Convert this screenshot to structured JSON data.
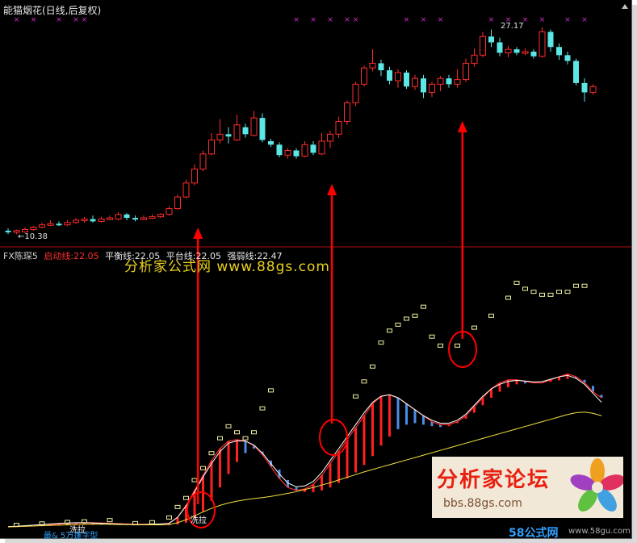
{
  "window": {
    "title": "能猫烟花(日线,后复权)"
  },
  "price_labels": {
    "high": "27.17",
    "low": "←10.38"
  },
  "indicator": {
    "name": "FX陈琛5",
    "start_line": "启动线:22.05",
    "balance_line": "平衡线:22.05",
    "platform_line": "平台线:22.05",
    "strength_line": "强弱线:22.47"
  },
  "watermark": {
    "text": "分析家公式网 www.88gs.com"
  },
  "forum_logo": {
    "title": "分析家论坛",
    "url": "bbs.88gs.com"
  },
  "bottom": {
    "logo": "58公式网",
    "url": "www.58gu.com",
    "label": "最& 5万篷字型"
  },
  "marks": {
    "left": "洗拉",
    "right": "洗拉"
  },
  "colors": {
    "up": "#ff2b2b",
    "down": "#5ce6e6",
    "arrow": "#ff0000",
    "bar_red": "#ff2020",
    "bar_blue": "#4a8ee8",
    "line_yellow": "#f0e040",
    "signal_x": "#d030d0"
  },
  "candles": [
    {
      "o": 10.5,
      "c": 10.4,
      "h": 10.7,
      "l": 10.2
    },
    {
      "o": 10.4,
      "c": 10.5,
      "h": 10.6,
      "l": 10.2
    },
    {
      "o": 10.4,
      "c": 10.6,
      "h": 10.8,
      "l": 10.3
    },
    {
      "o": 10.6,
      "c": 10.8,
      "h": 10.9,
      "l": 10.5
    },
    {
      "o": 10.8,
      "c": 11.0,
      "h": 11.2,
      "l": 10.7
    },
    {
      "o": 11.0,
      "c": 11.1,
      "h": 11.4,
      "l": 10.9
    },
    {
      "o": 11.1,
      "c": 11.0,
      "h": 11.3,
      "l": 10.9
    },
    {
      "o": 11.0,
      "c": 11.2,
      "h": 11.4,
      "l": 10.9
    },
    {
      "o": 11.2,
      "c": 11.4,
      "h": 11.6,
      "l": 11.1
    },
    {
      "o": 11.4,
      "c": 11.5,
      "h": 11.7,
      "l": 11.2
    },
    {
      "o": 11.5,
      "c": 11.3,
      "h": 11.8,
      "l": 11.2
    },
    {
      "o": 11.3,
      "c": 11.5,
      "h": 11.7,
      "l": 11.2
    },
    {
      "o": 11.5,
      "c": 11.6,
      "h": 11.8,
      "l": 11.4
    },
    {
      "o": 11.5,
      "c": 11.9,
      "h": 12.1,
      "l": 11.4
    },
    {
      "o": 11.9,
      "c": 11.6,
      "h": 12.0,
      "l": 11.4
    },
    {
      "o": 11.6,
      "c": 11.5,
      "h": 11.8,
      "l": 11.3
    },
    {
      "o": 11.5,
      "c": 11.6,
      "h": 11.8,
      "l": 11.4
    },
    {
      "o": 11.6,
      "c": 11.7,
      "h": 11.9,
      "l": 11.5
    },
    {
      "o": 11.7,
      "c": 11.9,
      "h": 12.0,
      "l": 11.6
    },
    {
      "o": 11.9,
      "c": 12.4,
      "h": 12.6,
      "l": 11.8
    },
    {
      "o": 12.4,
      "c": 13.4,
      "h": 13.6,
      "l": 12.3
    },
    {
      "o": 13.4,
      "c": 14.6,
      "h": 14.9,
      "l": 13.3
    },
    {
      "o": 14.6,
      "c": 15.8,
      "h": 16.2,
      "l": 14.4
    },
    {
      "o": 15.8,
      "c": 17.1,
      "h": 17.4,
      "l": 15.6
    },
    {
      "o": 17.1,
      "c": 18.3,
      "h": 18.9,
      "l": 17.0
    },
    {
      "o": 18.3,
      "c": 18.8,
      "h": 20.1,
      "l": 18.0
    },
    {
      "o": 18.8,
      "c": 18.6,
      "h": 19.4,
      "l": 18.0
    },
    {
      "o": 18.3,
      "c": 19.6,
      "h": 20.5,
      "l": 18.2
    },
    {
      "o": 19.4,
      "c": 18.8,
      "h": 19.7,
      "l": 18.5
    },
    {
      "o": 18.7,
      "c": 20.2,
      "h": 20.8,
      "l": 18.6
    },
    {
      "o": 20.2,
      "c": 18.3,
      "h": 20.6,
      "l": 18.1
    },
    {
      "o": 18.2,
      "c": 17.9,
      "h": 18.4,
      "l": 17.7
    },
    {
      "o": 17.9,
      "c": 17.0,
      "h": 18.1,
      "l": 16.8
    },
    {
      "o": 17.0,
      "c": 17.4,
      "h": 17.6,
      "l": 16.7
    },
    {
      "o": 17.4,
      "c": 16.9,
      "h": 17.6,
      "l": 16.7
    },
    {
      "o": 16.9,
      "c": 17.9,
      "h": 18.2,
      "l": 16.8
    },
    {
      "o": 17.9,
      "c": 17.2,
      "h": 18.2,
      "l": 17.0
    },
    {
      "o": 17.1,
      "c": 18.2,
      "h": 18.9,
      "l": 17.0
    },
    {
      "o": 18.2,
      "c": 18.8,
      "h": 19.1,
      "l": 17.6
    },
    {
      "o": 18.8,
      "c": 19.9,
      "h": 20.3,
      "l": 18.5
    },
    {
      "o": 19.9,
      "c": 21.5,
      "h": 21.7,
      "l": 19.6
    },
    {
      "o": 21.5,
      "c": 23.1,
      "h": 23.3,
      "l": 21.2
    },
    {
      "o": 23.1,
      "c": 24.5,
      "h": 24.7,
      "l": 22.9
    },
    {
      "o": 24.5,
      "c": 24.9,
      "h": 26.1,
      "l": 24.2
    },
    {
      "o": 24.9,
      "c": 24.3,
      "h": 25.2,
      "l": 23.8
    },
    {
      "o": 24.3,
      "c": 23.4,
      "h": 24.6,
      "l": 23.1
    },
    {
      "o": 23.4,
      "c": 24.1,
      "h": 24.4,
      "l": 22.8
    },
    {
      "o": 24.1,
      "c": 22.9,
      "h": 24.3,
      "l": 22.7
    },
    {
      "o": 22.9,
      "c": 23.6,
      "h": 23.9,
      "l": 22.6
    },
    {
      "o": 23.6,
      "c": 22.4,
      "h": 23.9,
      "l": 21.9
    },
    {
      "o": 22.4,
      "c": 23.1,
      "h": 23.3,
      "l": 22.0
    },
    {
      "o": 23.1,
      "c": 23.6,
      "h": 23.8,
      "l": 22.5
    },
    {
      "o": 23.6,
      "c": 23.1,
      "h": 23.9,
      "l": 22.8
    },
    {
      "o": 23.1,
      "c": 23.5,
      "h": 24.4,
      "l": 22.8
    },
    {
      "o": 23.5,
      "c": 24.9,
      "h": 25.3,
      "l": 23.3
    },
    {
      "o": 24.9,
      "c": 25.6,
      "h": 26.2,
      "l": 24.6
    },
    {
      "o": 25.6,
      "c": 27.2,
      "h": 27.6,
      "l": 25.4
    },
    {
      "o": 27.2,
      "c": 26.7,
      "h": 27.8,
      "l": 26.3
    },
    {
      "o": 26.7,
      "c": 25.8,
      "h": 27.1,
      "l": 25.5
    },
    {
      "o": 25.8,
      "c": 26.1,
      "h": 26.4,
      "l": 25.4
    },
    {
      "o": 26.1,
      "c": 25.8,
      "h": 26.3,
      "l": 25.6
    },
    {
      "o": 25.8,
      "c": 25.9,
      "h": 26.2,
      "l": 25.6
    },
    {
      "o": 25.9,
      "c": 25.5,
      "h": 26.1,
      "l": 25.3
    },
    {
      "o": 25.5,
      "c": 27.6,
      "h": 28.0,
      "l": 25.4
    },
    {
      "o": 27.6,
      "c": 26.3,
      "h": 27.8,
      "l": 25.9
    },
    {
      "o": 26.3,
      "c": 25.6,
      "h": 26.6,
      "l": 25.2
    },
    {
      "o": 25.6,
      "c": 25.1,
      "h": 25.9,
      "l": 24.8
    },
    {
      "o": 25.1,
      "c": 23.2,
      "h": 25.3,
      "l": 23.0
    },
    {
      "o": 23.2,
      "c": 22.4,
      "h": 23.6,
      "l": 21.6
    },
    {
      "o": 22.4,
      "c": 22.9,
      "h": 23.1,
      "l": 22.2
    }
  ],
  "signal_x_candles": [
    1,
    3,
    6,
    8,
    9,
    34,
    36,
    38,
    40,
    41,
    47,
    49,
    51,
    57,
    59,
    61,
    63,
    66,
    68
  ],
  "indicator_series": {
    "strong": [
      0.8,
      0.9,
      1.0,
      1.1,
      1.3,
      1.5,
      1.8,
      2.0,
      2.1,
      2.2,
      2.2,
      2.1,
      2.0,
      1.9,
      1.8,
      1.7,
      1.7,
      1.7,
      1.8,
      2.0,
      4.0,
      8.0,
      13,
      18,
      23,
      27,
      29.5,
      30,
      29.5,
      28,
      25,
      21,
      17,
      14,
      13,
      13.5,
      15,
      18,
      22,
      26,
      30,
      34,
      38,
      42,
      44.5,
      45,
      44,
      42,
      40,
      38,
      36,
      35,
      35,
      36,
      38,
      41,
      44,
      47,
      49,
      50,
      50,
      49.5,
      49,
      49,
      50,
      51,
      52,
      51,
      49,
      46,
      44
    ],
    "weak": [
      0.8,
      0.8,
      0.9,
      0.9,
      1.0,
      1.1,
      1.2,
      1.3,
      1.4,
      1.5,
      1.5,
      1.5,
      1.5,
      1.5,
      1.4,
      1.4,
      1.4,
      1.4,
      1.4,
      1.4,
      1.6,
      2.2,
      3.6,
      6.0,
      9.5,
      14,
      18.5,
      22.5,
      25.5,
      27,
      26,
      23,
      20,
      16.5,
      14,
      12.5,
      12.4,
      13,
      14,
      15.5,
      17,
      19,
      21.5,
      24.5,
      28,
      31,
      33.5,
      35,
      35.5,
      35,
      34.5,
      34.2,
      34.5,
      35.5,
      37,
      39,
      41.5,
      44,
      46,
      47.5,
      48.5,
      48.8,
      48.8,
      49,
      49.3,
      49.8,
      50.3,
      50.5,
      50,
      48,
      45
    ],
    "yellow": [
      0.8,
      0.9,
      1.0,
      1.1,
      1.2,
      1.3,
      1.4,
      1.5,
      1.6,
      1.7,
      1.7,
      1.7,
      1.7,
      1.6,
      1.6,
      1.5,
      1.5,
      1.5,
      1.5,
      1.6,
      2.2,
      3.2,
      4.5,
      5.8,
      7.0,
      8.0,
      8.8,
      9.4,
      9.9,
      10.3,
      10.6,
      11.0,
      11.5,
      12.0,
      12.6,
      13.3,
      14.0,
      14.8,
      15.6,
      16.5,
      17.4,
      18.3,
      19.2,
      20.0,
      20.8,
      21.6,
      22.4,
      23.2,
      24.0,
      24.8,
      25.6,
      26.4,
      27.2,
      28.0,
      28.8,
      29.6,
      30.4,
      31.2,
      32.0,
      32.8,
      33.6,
      34.4,
      35.2,
      36.0,
      36.8,
      37.6,
      38.4,
      39.0,
      39.2,
      38.8,
      38.0
    ],
    "white": [
      0.9,
      1.0,
      1.2,
      1.4,
      1.6,
      1.8,
      2.0,
      2.1,
      2.2,
      2.2,
      2.1,
      2.0,
      1.9,
      1.8,
      1.7,
      1.6,
      1.6,
      1.7,
      1.8,
      2.0,
      4.0,
      7.8,
      12.5,
      17.5,
      22,
      26,
      28.8,
      29.6,
      29.5,
      28.2,
      25.5,
      22,
      18.5,
      15.5,
      14.2,
      14.5,
      16,
      19,
      23,
      27,
      31,
      35,
      39,
      42.5,
      44.5,
      45,
      44,
      42,
      40,
      38,
      36.5,
      35.5,
      35.5,
      36.5,
      38.5,
      41.5,
      44.5,
      47,
      48.5,
      49.5,
      49.8,
      49.6,
      49.3,
      49.4,
      50.2,
      51,
      51.5,
      50.5,
      48.5,
      45.5,
      42.5
    ],
    "dashes": [
      {
        "i": 1,
        "v": 2
      },
      {
        "i": 4,
        "v": 2.5
      },
      {
        "i": 7,
        "v": 3
      },
      {
        "i": 9,
        "v": 3.2
      },
      {
        "i": 12,
        "v": 3.6
      },
      {
        "i": 15,
        "v": 2.6
      },
      {
        "i": 17,
        "v": 2.9
      },
      {
        "i": 19,
        "v": 4.5
      },
      {
        "i": 20,
        "v": 8
      },
      {
        "i": 21,
        "v": 11
      },
      {
        "i": 22,
        "v": 17
      },
      {
        "i": 23,
        "v": 21
      },
      {
        "i": 24,
        "v": 26
      },
      {
        "i": 25,
        "v": 31
      },
      {
        "i": 26,
        "v": 35
      },
      {
        "i": 27,
        "v": 33
      },
      {
        "i": 28,
        "v": 31
      },
      {
        "i": 29,
        "v": 33
      },
      {
        "i": 30,
        "v": 41
      },
      {
        "i": 31,
        "v": 47
      },
      {
        "i": 41,
        "v": 45
      },
      {
        "i": 42,
        "v": 50
      },
      {
        "i": 43,
        "v": 55
      },
      {
        "i": 44,
        "v": 63
      },
      {
        "i": 45,
        "v": 67
      },
      {
        "i": 46,
        "v": 69
      },
      {
        "i": 47,
        "v": 71
      },
      {
        "i": 48,
        "v": 72
      },
      {
        "i": 49,
        "v": 75
      },
      {
        "i": 50,
        "v": 65
      },
      {
        "i": 51,
        "v": 62
      },
      {
        "i": 53,
        "v": 62
      },
      {
        "i": 55,
        "v": 68
      },
      {
        "i": 57,
        "v": 72
      },
      {
        "i": 59,
        "v": 78
      },
      {
        "i": 60,
        "v": 83
      },
      {
        "i": 61,
        "v": 81
      },
      {
        "i": 62,
        "v": 80
      },
      {
        "i": 63,
        "v": 79
      },
      {
        "i": 64,
        "v": 79
      },
      {
        "i": 65,
        "v": 80
      },
      {
        "i": 66,
        "v": 80
      },
      {
        "i": 67,
        "v": 82
      },
      {
        "i": 68,
        "v": 82
      }
    ]
  }
}
